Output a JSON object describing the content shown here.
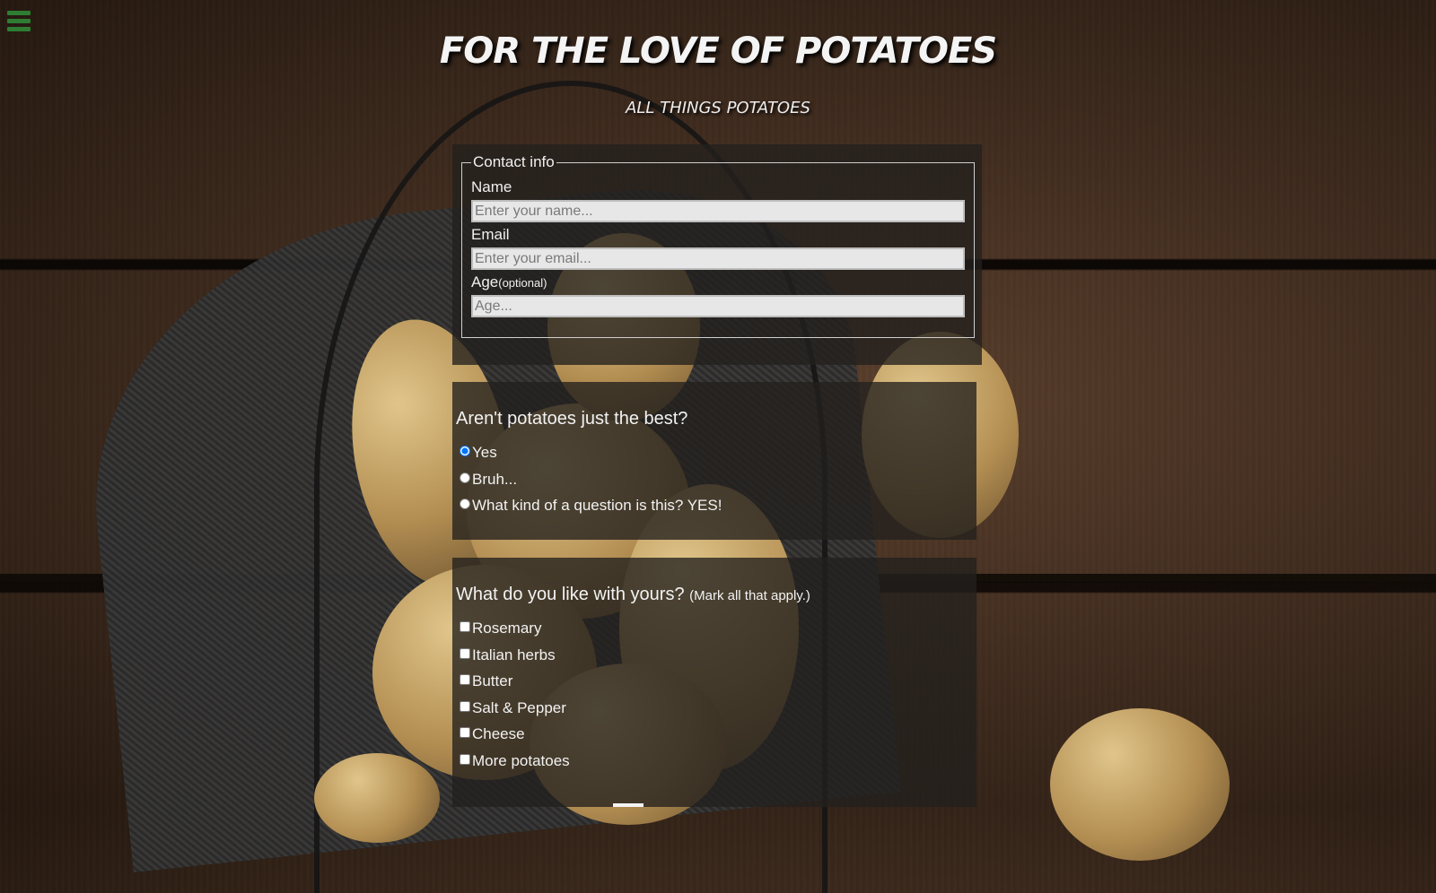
{
  "header": {
    "title": "FOR THE LOVE OF POTATOES",
    "subtitle": "ALL THINGS POTATOES",
    "menu_icon": "hamburger-menu-icon",
    "menu_color": "#2e7d32"
  },
  "contact": {
    "legend": "Contact info",
    "name_label": "Name",
    "name_placeholder": "Enter your name...",
    "name_value": "",
    "email_label": "Email",
    "email_placeholder": "Enter your email...",
    "email_value": "",
    "age_label": "Age",
    "age_note": "(optional)",
    "age_placeholder": "Age...",
    "age_value": ""
  },
  "question1": {
    "title": "Aren't potatoes just the best?",
    "options": [
      {
        "label": "Yes",
        "selected": true
      },
      {
        "label": "Bruh...",
        "selected": false
      },
      {
        "label": "What kind of a question is this? YES!",
        "selected": false
      }
    ]
  },
  "question2": {
    "title": "What do you like with yours?",
    "note": "(Mark all that apply.)",
    "options": [
      {
        "label": "Rosemary",
        "checked": false
      },
      {
        "label": "Italian herbs",
        "checked": false
      },
      {
        "label": "Butter",
        "checked": false
      },
      {
        "label": "Salt & Pepper",
        "checked": false
      },
      {
        "label": "Cheese",
        "checked": false
      },
      {
        "label": "More potatoes",
        "checked": false
      }
    ]
  }
}
